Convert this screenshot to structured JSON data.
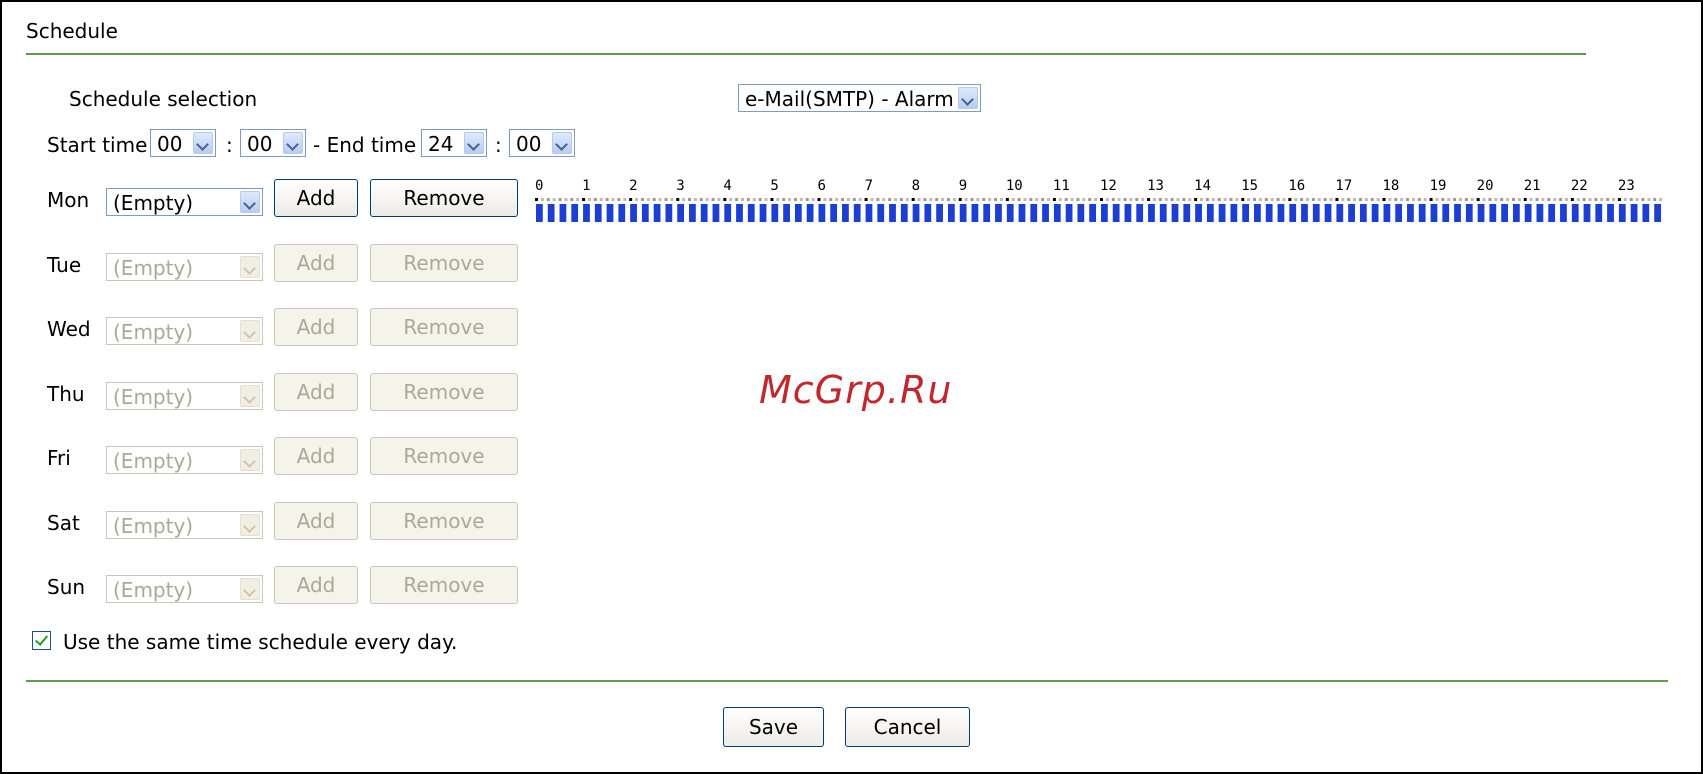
{
  "section_title": "Schedule",
  "schedule_selection": {
    "label": "Schedule selection",
    "value": "e-Mail(SMTP) - Alarm"
  },
  "time_range": {
    "start_label": "Start time",
    "start_hour": "00",
    "start_minute": "00",
    "separator": ":",
    "end_label": "- End time",
    "end_hour": "24",
    "end_minute": "00"
  },
  "days": [
    {
      "label": "Mon",
      "value": "(Empty)",
      "add": "Add",
      "remove": "Remove",
      "enabled": true
    },
    {
      "label": "Tue",
      "value": "(Empty)",
      "add": "Add",
      "remove": "Remove",
      "enabled": false
    },
    {
      "label": "Wed",
      "value": "(Empty)",
      "add": "Add",
      "remove": "Remove",
      "enabled": false
    },
    {
      "label": "Thu",
      "value": "(Empty)",
      "add": "Add",
      "remove": "Remove",
      "enabled": false
    },
    {
      "label": "Fri",
      "value": "(Empty)",
      "add": "Add",
      "remove": "Remove",
      "enabled": false
    },
    {
      "label": "Sat",
      "value": "(Empty)",
      "add": "Add",
      "remove": "Remove",
      "enabled": false
    },
    {
      "label": "Sun",
      "value": "(Empty)",
      "add": "Add",
      "remove": "Remove",
      "enabled": false
    }
  ],
  "timeline": {
    "hours": [
      "0",
      "1",
      "2",
      "3",
      "4",
      "5",
      "6",
      "7",
      "8",
      "9",
      "10",
      "11",
      "12",
      "13",
      "14",
      "15",
      "16",
      "17",
      "18",
      "19",
      "20",
      "21",
      "22",
      "23"
    ],
    "active_color": "#1a3fd1",
    "selected_range": [
      0,
      24
    ]
  },
  "same_schedule": {
    "label": "Use the same time schedule every day.",
    "checked": true
  },
  "footer": {
    "save": "Save",
    "cancel": "Cancel"
  },
  "watermark": "McGrp.Ru",
  "colors": {
    "rule": "#5f9b4a",
    "button_border": "#003c74",
    "disabled_text": "#aca899"
  }
}
